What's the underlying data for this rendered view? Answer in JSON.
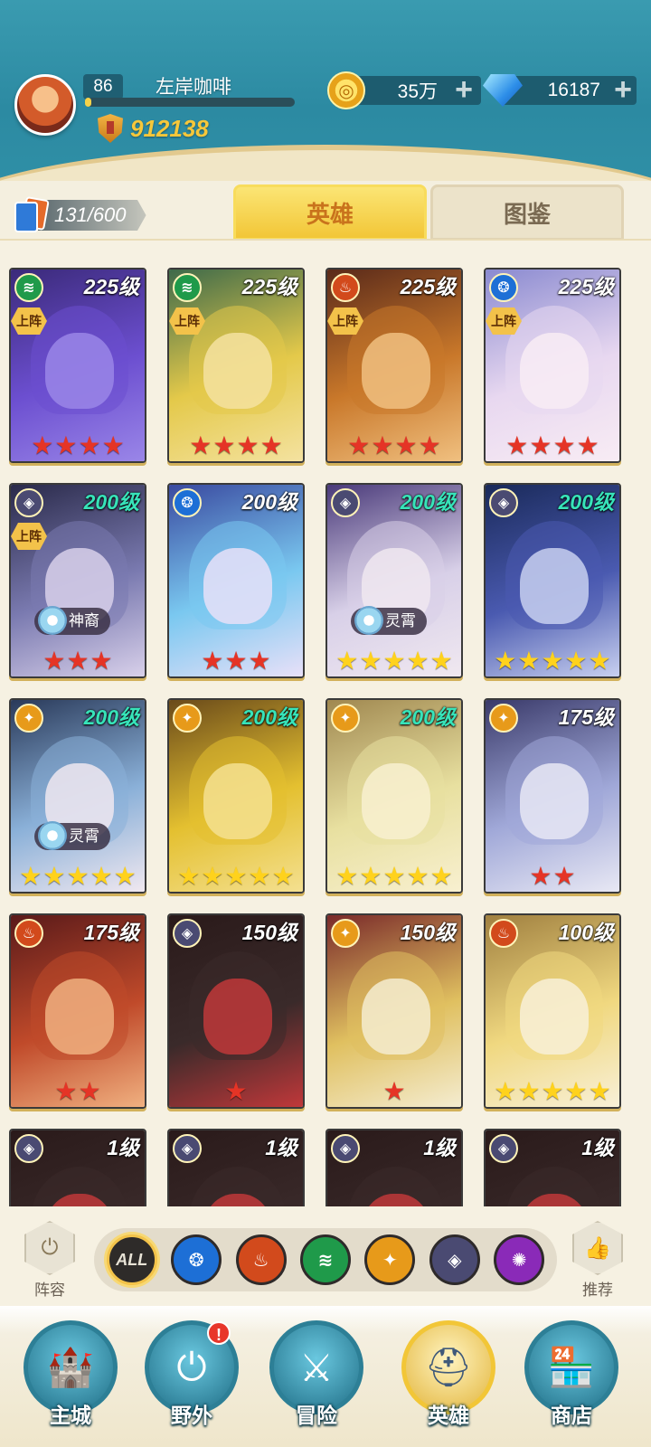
{
  "player": {
    "level": "86",
    "name": "左岸咖啡",
    "xp_progress": 0.03,
    "power": "912138"
  },
  "resources": {
    "gold": "35万",
    "diamonds": "16187"
  },
  "collection": {
    "count": "131/600"
  },
  "tabs": [
    {
      "label": "英雄",
      "active": true
    },
    {
      "label": "图鉴",
      "active": false
    }
  ],
  "heroes": [
    {
      "level": "225级",
      "element": "wind",
      "deployed": "上阵",
      "stars": 4,
      "star_color": "red",
      "level_color": "white",
      "faction": ""
    },
    {
      "level": "225级",
      "element": "wind",
      "deployed": "上阵",
      "stars": 4,
      "star_color": "red",
      "level_color": "white",
      "faction": ""
    },
    {
      "level": "225级",
      "element": "fire",
      "deployed": "上阵",
      "stars": 4,
      "star_color": "red",
      "level_color": "white",
      "faction": ""
    },
    {
      "level": "225级",
      "element": "water",
      "deployed": "上阵",
      "stars": 4,
      "star_color": "red",
      "level_color": "white",
      "faction": ""
    },
    {
      "level": "200级",
      "element": "dark",
      "deployed": "上阵",
      "stars": 3,
      "star_color": "red",
      "level_color": "teal",
      "faction": "神裔"
    },
    {
      "level": "200级",
      "element": "water",
      "deployed": "",
      "stars": 3,
      "star_color": "red",
      "level_color": "white",
      "faction": ""
    },
    {
      "level": "200级",
      "element": "dark",
      "deployed": "",
      "stars": 5,
      "star_color": "gold",
      "level_color": "teal",
      "faction": "灵霄"
    },
    {
      "level": "200级",
      "element": "dark",
      "deployed": "",
      "stars": 5,
      "star_color": "gold",
      "level_color": "teal",
      "faction": ""
    },
    {
      "level": "200级",
      "element": "light",
      "deployed": "",
      "stars": 5,
      "star_color": "gold",
      "level_color": "teal",
      "faction": "灵霄"
    },
    {
      "level": "200级",
      "element": "light",
      "deployed": "",
      "stars": 5,
      "star_color": "gold",
      "level_color": "teal",
      "faction": ""
    },
    {
      "level": "200级",
      "element": "light",
      "deployed": "",
      "stars": 5,
      "star_color": "gold",
      "level_color": "teal",
      "faction": ""
    },
    {
      "level": "175级",
      "element": "light",
      "deployed": "",
      "stars": 2,
      "star_color": "red",
      "level_color": "white",
      "faction": ""
    },
    {
      "level": "175级",
      "element": "fire",
      "deployed": "",
      "stars": 2,
      "star_color": "red",
      "level_color": "white",
      "faction": ""
    },
    {
      "level": "150级",
      "element": "dark",
      "deployed": "",
      "stars": 1,
      "star_color": "red",
      "level_color": "white",
      "faction": ""
    },
    {
      "level": "150级",
      "element": "light",
      "deployed": "",
      "stars": 1,
      "star_color": "red",
      "level_color": "white",
      "faction": ""
    },
    {
      "level": "100级",
      "element": "fire",
      "deployed": "",
      "stars": 5,
      "star_color": "gold",
      "level_color": "white",
      "faction": ""
    },
    {
      "level": "1级",
      "element": "dark",
      "deployed": "",
      "stars": 0,
      "star_color": "red",
      "level_color": "white",
      "faction": ""
    },
    {
      "level": "1级",
      "element": "dark",
      "deployed": "",
      "stars": 0,
      "star_color": "red",
      "level_color": "white",
      "faction": ""
    },
    {
      "level": "1级",
      "element": "dark",
      "deployed": "",
      "stars": 0,
      "star_color": "red",
      "level_color": "white",
      "faction": ""
    },
    {
      "level": "1级",
      "element": "dark",
      "deployed": "",
      "stars": 0,
      "star_color": "red",
      "level_color": "white",
      "faction": ""
    }
  ],
  "filter_bar": {
    "lineup_label": "阵容",
    "recommend_label": "推荐",
    "filters": [
      {
        "label": "ALL",
        "name": "all",
        "color": "#2e2b29"
      },
      {
        "label": "",
        "name": "water",
        "color": "#1d6fd6"
      },
      {
        "label": "",
        "name": "fire",
        "color": "#d24a1c"
      },
      {
        "label": "",
        "name": "wind",
        "color": "#1f9a4a"
      },
      {
        "label": "",
        "name": "light",
        "color": "#e79a1a"
      },
      {
        "label": "",
        "name": "dark",
        "color": "#4a4a72"
      },
      {
        "label": "",
        "name": "arcane",
        "color": "#8a2ab8"
      }
    ]
  },
  "nav": [
    {
      "label": "主城",
      "icon": "castle-icon",
      "active": false,
      "badge": ""
    },
    {
      "label": "野外",
      "icon": "portal-icon",
      "active": false,
      "badge": "!"
    },
    {
      "label": "冒险",
      "icon": "sword-icon",
      "active": false,
      "badge": ""
    },
    {
      "label": "英雄",
      "icon": "helmet-icon",
      "active": true,
      "badge": ""
    },
    {
      "label": "商店",
      "icon": "shop-icon",
      "active": false,
      "badge": ""
    }
  ],
  "colors": {
    "element_wind": "#1f9a4a",
    "element_fire": "#d24a1c",
    "element_water": "#1d6fd6",
    "element_dark": "#4a4a72",
    "element_light": "#e79a1a"
  }
}
